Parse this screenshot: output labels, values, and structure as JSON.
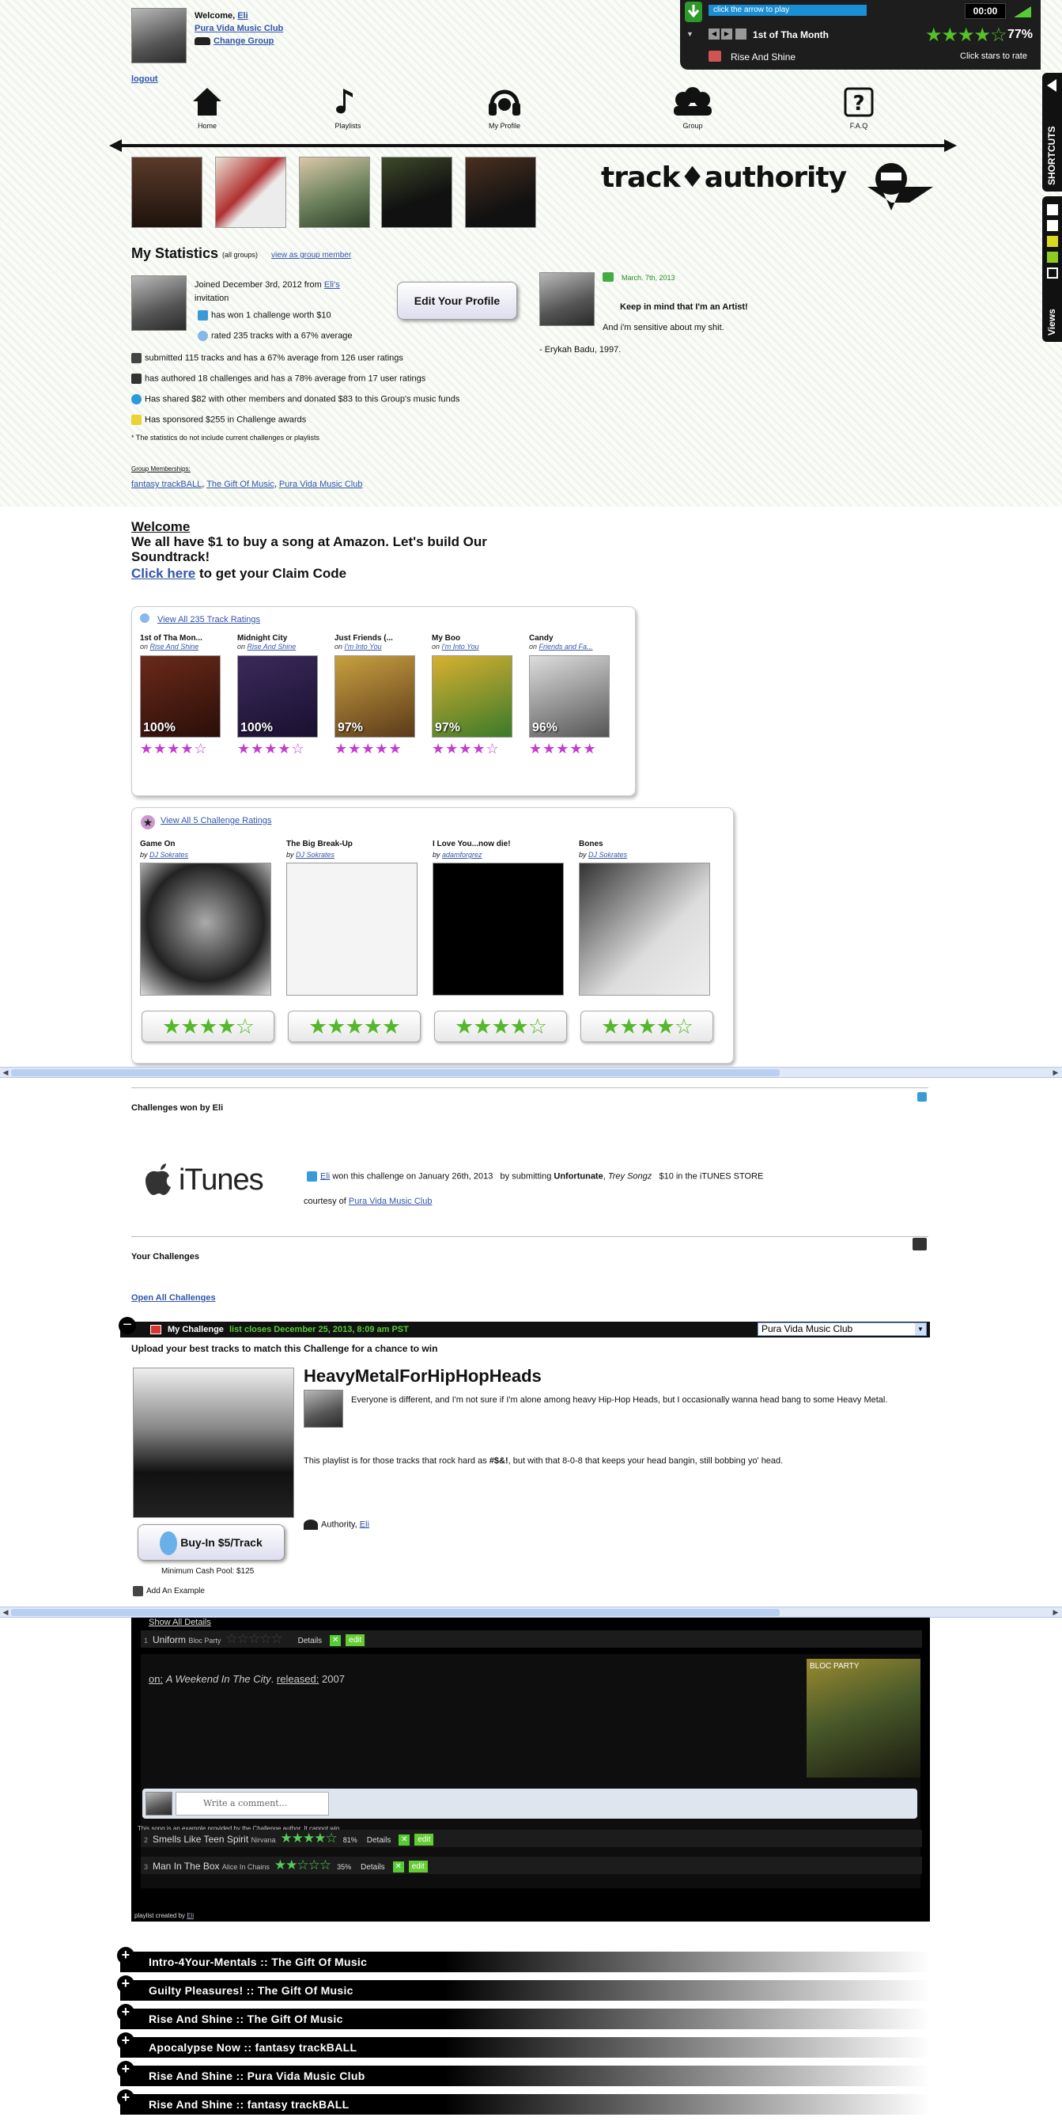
{
  "header": {
    "welcome": "Welcome,",
    "user": "Eli",
    "group": "Pura Vida Music Club",
    "change_group": "Change Group",
    "logout": "logout"
  },
  "player": {
    "hint": "click the arrow to play",
    "time": "00:00",
    "track": "1st of Tha Month",
    "percent": "77%",
    "playlist": "Rise And Shine",
    "rate_hint": "Click stars to rate",
    "rating_stars": 4
  },
  "side_tabs": {
    "shortcuts": "SHORTCUTS",
    "views": "Views"
  },
  "nav": [
    {
      "label": "Home",
      "icon": "home-icon"
    },
    {
      "label": "Playlists",
      "icon": "music-note-icon"
    },
    {
      "label": "My Profile",
      "icon": "headphones-icon"
    },
    {
      "label": "Group",
      "icon": "group-icon"
    },
    {
      "label": "F.A.Q",
      "icon": "question-icon"
    }
  ],
  "logo": "track♦authority",
  "stats": {
    "title": "My Statistics",
    "scope": "(all groups)",
    "view_as": "view as group member",
    "joined_pre": "Joined December 3rd, 2012 from",
    "joined_user": "Eli's",
    "joined_post": "invitation",
    "edit_profile": "Edit Your Profile",
    "challenges_won": "has won 1 challenge worth $10",
    "rated": "rated 235 tracks with a 67% average",
    "submitted": "submitted 115 tracks and has a 67% average from 126 user ratings",
    "authored": "has authored 18 challenges and has a 78% average from 17 user ratings",
    "shared": "Has shared $82 with other members and donated $83 to this Group's music funds",
    "sponsored": "Has sponsored $255 in Challenge awards",
    "note": "* The statistics do not include current challenges or playlists",
    "memberships_label": "Group Memberships:",
    "memberships": [
      "fantasy trackBALL",
      "The Gift Of Music",
      "Pura Vida Music Club"
    ]
  },
  "quote": {
    "date": "March. 7th, 2013",
    "line1": "Keep in mind that I'm an Artist!",
    "line2": "And i'm sensitive about my shit.",
    "attrib": "- Erykah Badu, 1997."
  },
  "welcome_box": {
    "title": "Welcome",
    "body": "We all have $1 to buy a song at Amazon. Let's build Our Soundtrack!",
    "click": "Click here",
    "click_rest": "to get your Claim Code"
  },
  "track_ratings": {
    "header": "View All 235 Track Ratings",
    "items": [
      {
        "title": "1st of Tha Mon...",
        "on": "on",
        "playlist": "Rise And Shine",
        "pct": "100%",
        "stars": 4
      },
      {
        "title": "Midnight City",
        "on": "on",
        "playlist": "Rise And Shine",
        "pct": "100%",
        "stars": 4
      },
      {
        "title": "Just Friends (...",
        "on": "on",
        "playlist": "I'm Into You",
        "pct": "97%",
        "stars": 4.5
      },
      {
        "title": "My Boo",
        "on": "on",
        "playlist": "I'm Into You",
        "pct": "97%",
        "stars": 4
      },
      {
        "title": "Candy",
        "on": "on",
        "playlist": "Friends and Fa...",
        "pct": "96%",
        "stars": 4.5
      }
    ]
  },
  "challenge_ratings": {
    "header": "View All 5 Challenge Ratings",
    "items": [
      {
        "title": "Game On",
        "by": "by",
        "author": "DJ Sokrates",
        "stars": 4
      },
      {
        "title": "The Big Break-Up",
        "by": "by",
        "author": "DJ Sokrates",
        "stars": 5
      },
      {
        "title": "I Love You...now die!",
        "by": "by",
        "author": "adamforgrez",
        "stars": 4
      },
      {
        "title": "Bones",
        "by": "by",
        "author": "DJ Sokrates",
        "stars": 4
      }
    ]
  },
  "won": {
    "title": "Challenges won by Eli",
    "itunes": "iTunes",
    "user": "Eli",
    "text1": "won this challenge on January 26th, 2013",
    "text2": "by submitting",
    "track": "Unfortunate",
    "artist": "Trey Songz",
    "prize": "$10 in the iTUNES STORE",
    "courtesy": "courtesy of",
    "group": "Pura Vida Music Club"
  },
  "your_challenges": {
    "title": "Your Challenges",
    "open_all": "Open All Challenges",
    "bar_label": "My Challenge",
    "bar_status": "list closes December 25, 2013, 8:09 am PST",
    "select_value": "Pura Vida Music Club",
    "upload": "Upload your best tracks to match this Challenge for a chance to win",
    "name": "HeavyMetalForHipHopHeads",
    "desc1": "Everyone is different, and I'm not sure if I'm alone among heavy Hip-Hop Heads, but I occasionally wanna head bang to some Heavy Metal.",
    "desc2_pre": "This playlist is for those tracks that rock hard as",
    "desc2_bold": "#$&!",
    "desc2_post": ", but with that 8-0-8 that keeps your head bangin, still bobbing yo' head.",
    "authority": "Authority,",
    "authority_user": "Eli",
    "buy_in": "Buy-In $5/Track",
    "min_pool": "Minimum Cash Pool: $125",
    "add_example": "Add An Example"
  },
  "playlist": {
    "show_all": "Show All Details",
    "tracks": [
      {
        "num": "1",
        "title": "Uniform",
        "artist": "Bloc Party",
        "pct": "",
        "stars": 0,
        "details": "Details",
        "edit": "edit"
      },
      {
        "num": "2",
        "title": "Smells Like Teen Spirit",
        "artist": "Nirvana",
        "pct": "81%",
        "stars": 4,
        "details": "Details",
        "edit": "edit"
      },
      {
        "num": "3",
        "title": "Man In The Box",
        "artist": "Alice In Chains",
        "pct": "35%",
        "stars": 2,
        "details": "Details",
        "edit": "edit"
      }
    ],
    "on": "on:",
    "album": "A Weekend In The City",
    "released_label": "released:",
    "year": "2007",
    "album_art_label": "BLOC PARTY",
    "comment_placeholder": "Write a comment...",
    "example_note": "This song is an example provided by the Challenge author. It cannot win",
    "created_by": "playlist created by",
    "created_user": "Eli"
  },
  "other_challenges": [
    "Intro-4Your-Mentals :: The Gift Of Music",
    "Guilty Pleasures! :: The Gift Of Music",
    "Rise And Shine :: The Gift Of Music",
    "Apocalypse Now :: fantasy trackBALL",
    "Rise And Shine :: Pura Vida Music Club",
    "Rise And Shine :: fantasy trackBALL"
  ]
}
